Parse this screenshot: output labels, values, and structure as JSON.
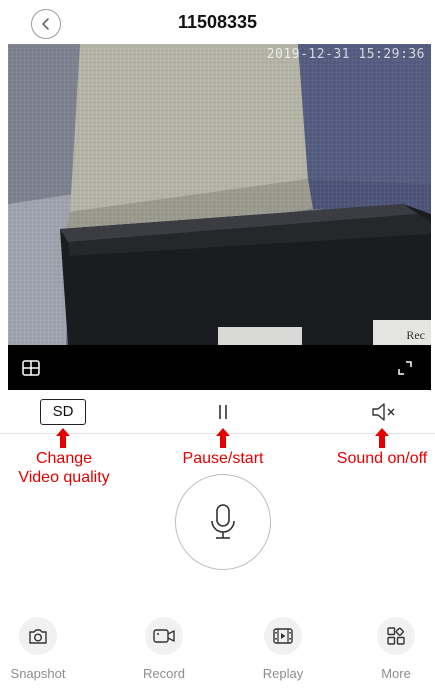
{
  "header": {
    "title": "11508335"
  },
  "video": {
    "timestamp": "2019-12-31 15:29:36",
    "rec_label": "Rec"
  },
  "controls": {
    "quality_label": "SD"
  },
  "annotations": {
    "quality": [
      "Change",
      "Video quality"
    ],
    "pause": "Pause/start",
    "sound": "Sound on/off"
  },
  "bottom_bar": [
    {
      "label": "Snapshot",
      "icon": "camera-icon"
    },
    {
      "label": "Record",
      "icon": "video-camera-icon"
    },
    {
      "label": "Replay",
      "icon": "film-icon"
    },
    {
      "label": "More",
      "icon": "more-grid-icon"
    }
  ],
  "colors": {
    "annotation": "#e30000",
    "toolbar_bg": "#000000"
  }
}
